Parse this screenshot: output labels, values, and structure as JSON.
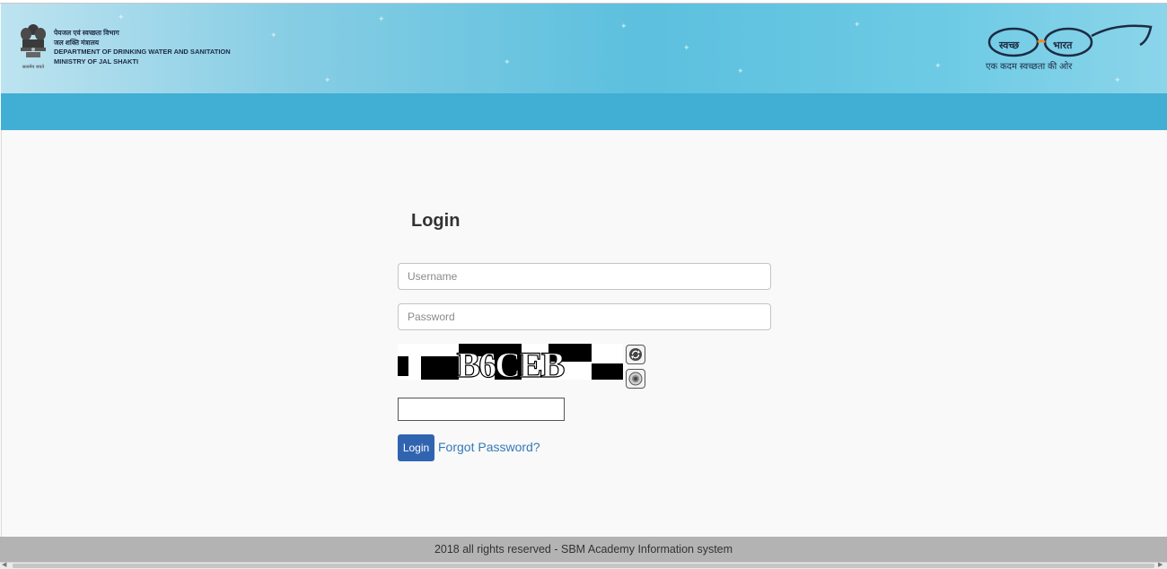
{
  "header": {
    "dept_lines": [
      "पेयजल एवं स्वच्छता विभाग",
      "जल शक्ति मंत्रालय",
      "DEPARTMENT OF DRINKING WATER AND SANITATION",
      "MINISTRY OF JAL SHAKTI"
    ],
    "emblem_caption": "सत्यमेव जयते",
    "swachh_word1": "स्वच्छ",
    "swachh_word2": "भारत",
    "swachh_tagline": "एक कदम स्वच्छता की ओर"
  },
  "login": {
    "title": "Login",
    "username_placeholder": "Username",
    "password_placeholder": "Password",
    "captcha_text": "B6CEB",
    "captcha_input_value": "",
    "login_button": "Login",
    "forgot_password": "Forgot Password?"
  },
  "icons": {
    "refresh": "refresh-icon",
    "audio": "audio-icon"
  },
  "colors": {
    "banner_blue": "#41aed4",
    "button_blue": "#3164b0",
    "link_blue": "#337ab7",
    "footer_gray": "#b3b3b3"
  },
  "footer": {
    "text": "2018 all rights reserved - SBM Academy Information system"
  }
}
